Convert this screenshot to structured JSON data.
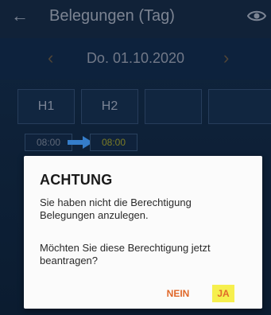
{
  "header": {
    "title": "Belegungen (Tag)",
    "back_icon": "back-arrow-icon",
    "view_icon": "eye-icon"
  },
  "datebar": {
    "date": "Do. 01.10.2020",
    "prev_icon": "chevron-left-icon",
    "next_icon": "chevron-right-icon"
  },
  "tabs": [
    {
      "label": "H1"
    },
    {
      "label": "H2"
    },
    {
      "label": ""
    },
    {
      "label": ""
    }
  ],
  "timeline": {
    "start": "08:00",
    "end": "08:00"
  },
  "dialog": {
    "title": "ACHTUNG",
    "message": "Sie haben nicht die Berechtigung Belegungen anzulegen.",
    "question": "Möchten Sie diese Berechtigung jetzt beantragen?",
    "no_label": "NEIN",
    "yes_label": "JA"
  },
  "colors": {
    "accent": "#e0682a",
    "highlight": "#f6ef4e",
    "background": "#0f2138"
  }
}
